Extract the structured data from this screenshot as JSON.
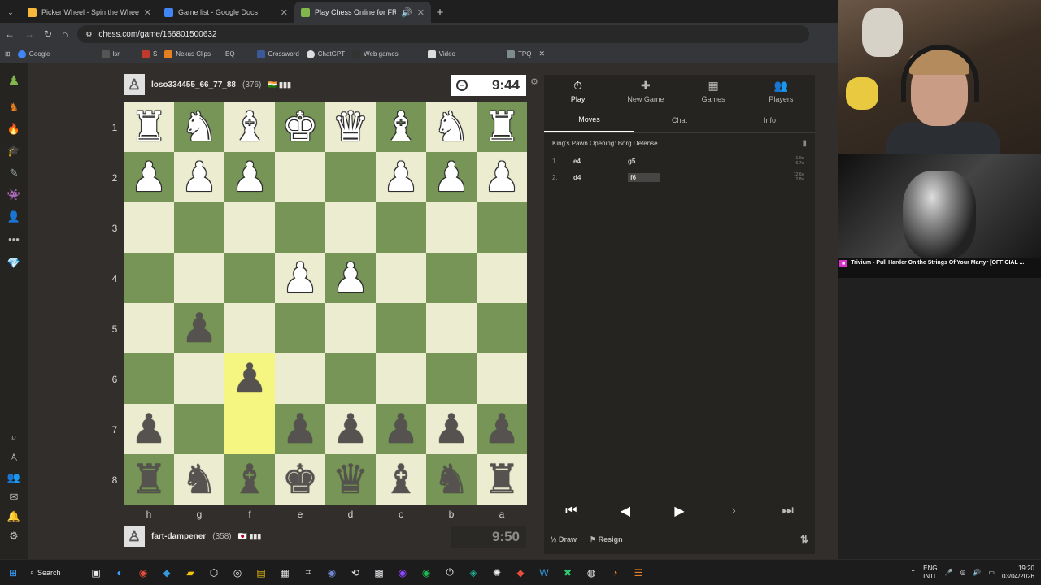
{
  "browser": {
    "tabs": [
      {
        "title": "Picker Wheel - Spin the Wheel",
        "color": "#f6b93b"
      },
      {
        "title": "Game list - Google Docs",
        "color": "#4285f4"
      },
      {
        "title": "Play Chess Online for FREE",
        "color": "#81b64c"
      }
    ],
    "url": "chess.com/game/166801500632",
    "bookmarks": [
      "Google",
      "lsr",
      "S",
      "Nexus Clips",
      "EQ",
      "Crossword",
      "ChatGPT",
      "Web games",
      "Video",
      "TPQ"
    ]
  },
  "game": {
    "top_player": {
      "name": "loso334455_66_77_88",
      "rating": "(376)",
      "clock": "9:44"
    },
    "bottom_player": {
      "name": "fart-dampener",
      "rating": "(358)",
      "clock": "9:50"
    },
    "ranks": [
      "1",
      "2",
      "3",
      "4",
      "5",
      "6",
      "7",
      "8"
    ],
    "files": [
      "h",
      "g",
      "f",
      "e",
      "d",
      "c",
      "b",
      "a"
    ],
    "board": [
      [
        "wR",
        "wN",
        "wB",
        "wK",
        "wQ",
        "wB",
        "wN",
        "wR"
      ],
      [
        "wP",
        "wP",
        "wP",
        "",
        "",
        "wP",
        "wP",
        "wP"
      ],
      [
        "",
        "",
        "",
        "",
        "",
        "",
        "",
        ""
      ],
      [
        "",
        "",
        "",
        "wP",
        "wP",
        "",
        "",
        ""
      ],
      [
        "",
        "bP",
        "",
        "",
        "",
        "",
        "",
        ""
      ],
      [
        "",
        "",
        "bP",
        "",
        "",
        "",
        "",
        ""
      ],
      [
        "bP",
        "",
        "",
        "bP",
        "bP",
        "bP",
        "bP",
        "bP"
      ],
      [
        "bR",
        "bN",
        "bB",
        "bK",
        "bQ",
        "bB",
        "bN",
        "bR"
      ]
    ],
    "highlight": [
      [
        5,
        2
      ],
      [
        6,
        2
      ]
    ]
  },
  "panel": {
    "top_tabs": [
      {
        "label": "Play",
        "icon": "stopwatch-icon",
        "glyph": "⏱"
      },
      {
        "label": "New Game",
        "icon": "plus-icon",
        "glyph": "✚"
      },
      {
        "label": "Games",
        "icon": "board-icon",
        "glyph": "▦"
      },
      {
        "label": "Players",
        "icon": "players-icon",
        "glyph": "👥"
      }
    ],
    "sub_tabs": [
      "Moves",
      "Chat",
      "Info"
    ],
    "opening": "King's Pawn Opening: Borg Defense",
    "moves": [
      {
        "num": "1.",
        "white": "e4",
        "black": "g5",
        "t1": "1.0s",
        "t2": "6.7s"
      },
      {
        "num": "2.",
        "white": "d4",
        "black": "f6",
        "t1": "12.6s",
        "t2": "2.8s"
      }
    ],
    "draw_label": "Draw",
    "resign_label": "Resign"
  },
  "stream": {
    "video_caption": "Trivium - Pull Harder On the Strings Of Your Martyr [OFFICIAL ..."
  },
  "taskbar": {
    "search_label": "Search",
    "lang_top": "ENG",
    "lang_bottom": "INTL",
    "time": "19:20",
    "date": "03/04/2026"
  }
}
